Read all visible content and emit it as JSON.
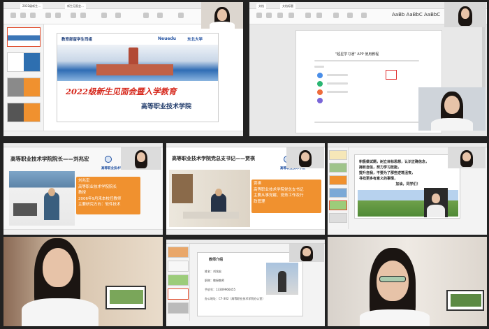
{
  "tile1": {
    "tabs": [
      "2022级新生…",
      "新生见面会…"
    ],
    "logo1": "教育部留学生司组",
    "logo2": "Neuedu",
    "logo3": "东北大学",
    "headline": "2022级新生见面会暨入学教育",
    "school": "高等职业技术学院"
  },
  "tile2": {
    "tabs": [
      "文档",
      "文档标题"
    ],
    "toolbar_text": "AaBb AaBbC AaBbC",
    "doc_title": "\"超星学习通\" APP 使用教程"
  },
  "tile3": {
    "title": "高等职业技术学院院长——刘兆宏",
    "school": "高等职业技术学院",
    "lines": [
      "刘兆宏",
      "高等职业技术学院院长",
      "教授",
      "2006年9月来本校任教师",
      "主要研究方向：软件技术"
    ]
  },
  "tile4": {
    "title": "高等职业技术学院党总支书记——贾祺",
    "school": "高等职业技术学院",
    "lines": [
      "贾祺",
      "高等职业技术学院党总支书记",
      "主要从事党建、党务工作及行",
      "政管理"
    ]
  },
  "tile5": {
    "text": [
      "积极做试题，树立目标思想，认识正确信念，",
      "拥有自信，努力学习技能，",
      "提升自我，不要为了那些逆境沮丧，",
      "寻找更多有意义的事情，",
      "加油，同学们！"
    ]
  },
  "tile8": {
    "card_title": "教师介绍",
    "rows": [
      {
        "label": "姓名：",
        "value": "刘兆宏"
      },
      {
        "label": "职称：",
        "value": "教授教师"
      },
      {
        "label": "手机号：",
        "value": "13309966455"
      },
      {
        "label": "办公地址：",
        "value": "C7-302（高等职业技术学院办公室）"
      }
    ]
  },
  "colors": {
    "accent_orange": "#f0912f",
    "brand_blue": "#1f4fa0",
    "headline_red": "#d6281c"
  }
}
